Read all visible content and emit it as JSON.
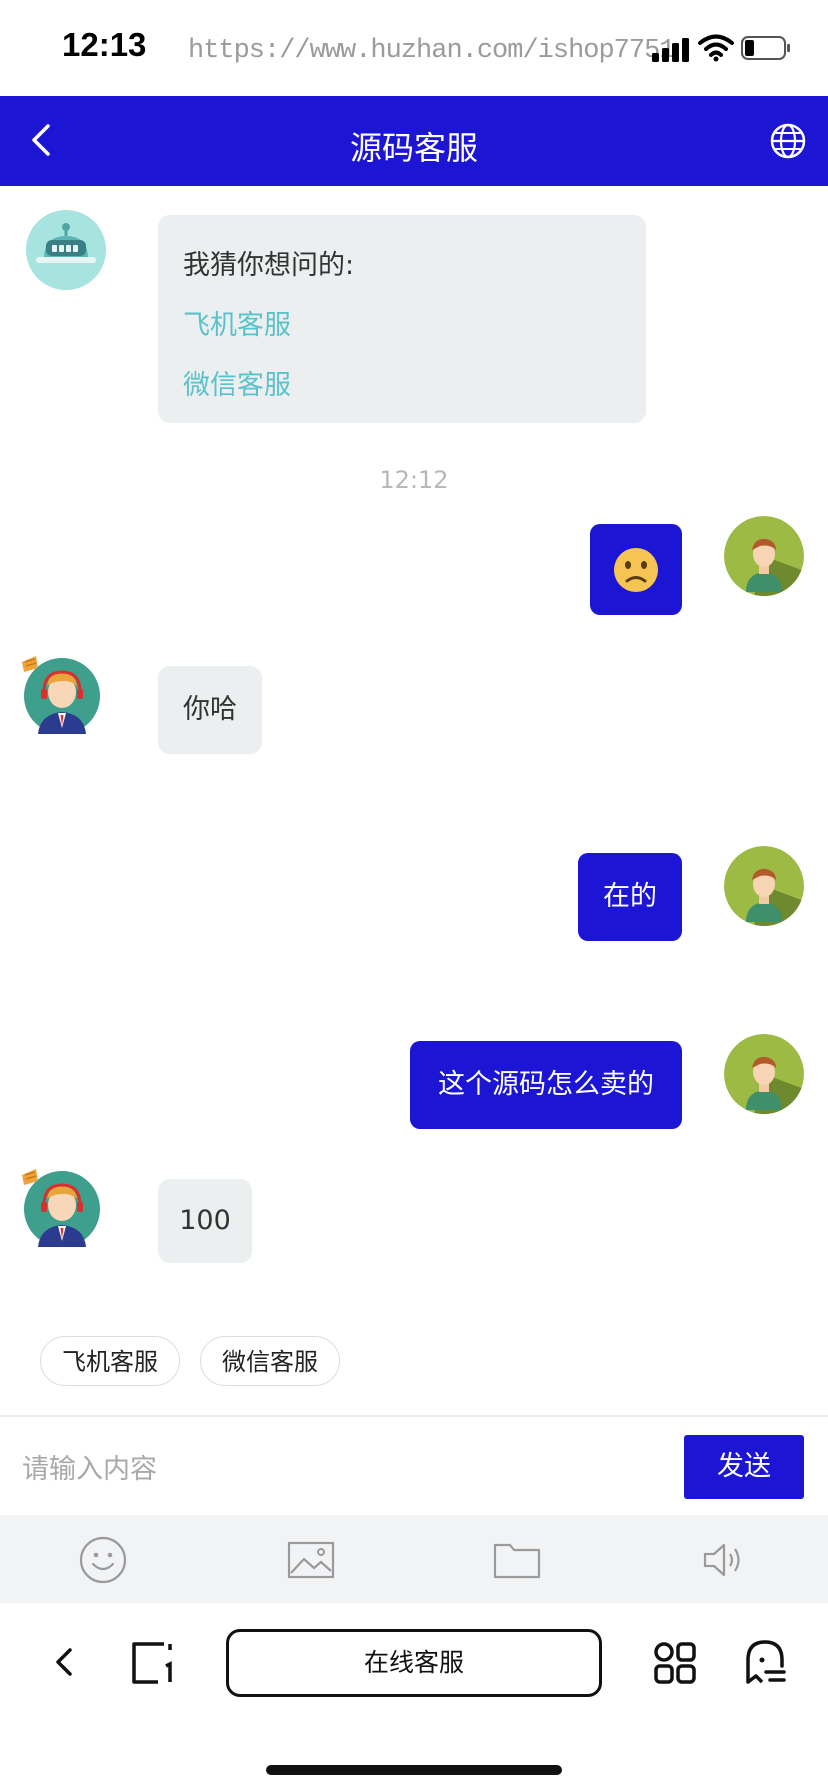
{
  "status_bar": {
    "time": "12:13",
    "url_watermark": "https://www.huzhan.com/ishop7751"
  },
  "header": {
    "title": "源码客服",
    "back_icon": "chevron-left-icon",
    "right_icon": "globe-icon"
  },
  "messages": {
    "bot_prompt": "我猜你想问的:",
    "bot_link_1": "飞机客服",
    "bot_link_2": "微信客服",
    "timestamp": "12:12",
    "user_emoji": "🙁",
    "agent_reply_1": "你哈",
    "user_reply_1": "在的",
    "user_reply_2": "这个源码怎么卖的",
    "agent_reply_2": "100"
  },
  "quick_replies": [
    "飞机客服",
    "微信客服"
  ],
  "composer": {
    "placeholder": "请输入内容",
    "send_label": "发送"
  },
  "toolbar": {
    "icons": [
      "smile-icon",
      "image-icon",
      "folder-icon",
      "speaker-icon"
    ]
  },
  "browser": {
    "address_text": "在线客服"
  },
  "colors": {
    "primary": "#1c16d4",
    "bubble_left": "#ebeff0",
    "link": "#5bc2cc"
  }
}
